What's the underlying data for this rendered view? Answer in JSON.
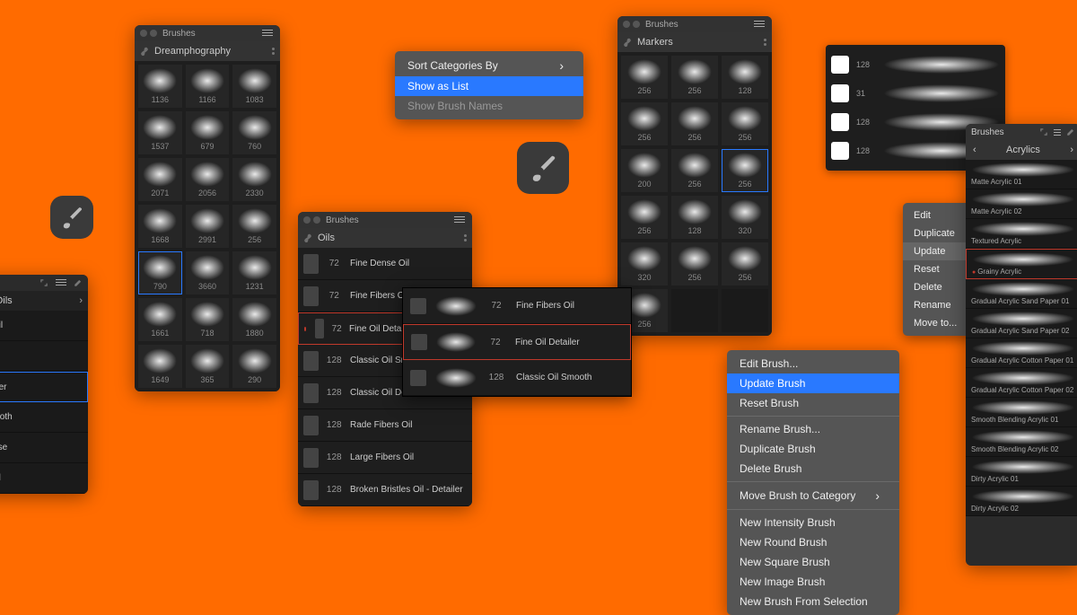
{
  "panel_grid": {
    "title": "Brushes",
    "category": "Dreamphography",
    "cells": [
      {
        "size": "1136"
      },
      {
        "size": "1166"
      },
      {
        "size": "1083"
      },
      {
        "size": "1537"
      },
      {
        "size": "679"
      },
      {
        "size": "760"
      },
      {
        "size": "2071"
      },
      {
        "size": "2056"
      },
      {
        "size": "2330"
      },
      {
        "size": "1668"
      },
      {
        "size": "2991"
      },
      {
        "size": "256"
      },
      {
        "size": "790",
        "selected": true
      },
      {
        "size": "3660"
      },
      {
        "size": "1231"
      },
      {
        "size": "1661"
      },
      {
        "size": "718"
      },
      {
        "size": "1880"
      },
      {
        "size": "1649"
      },
      {
        "size": "365"
      },
      {
        "size": "290"
      }
    ]
  },
  "panel_brushes2": {
    "title": "Brushes",
    "category": "Markers",
    "cells": [
      {
        "size": "256"
      },
      {
        "size": "256"
      },
      {
        "size": "128"
      },
      {
        "size": "256"
      },
      {
        "size": "256"
      },
      {
        "size": "256"
      },
      {
        "size": "200"
      },
      {
        "size": "256"
      },
      {
        "size": "256",
        "selected": true
      },
      {
        "size": "256"
      },
      {
        "size": "128"
      },
      {
        "size": "320"
      },
      {
        "size": "320"
      },
      {
        "size": "256"
      },
      {
        "size": "256"
      },
      {
        "size": "256"
      },
      {
        "size": ""
      },
      {
        "size": ""
      }
    ]
  },
  "panel_oils": {
    "title": "Brushes",
    "category": "Oils",
    "rows": [
      {
        "num": "72",
        "name": "Fine Dense Oil"
      },
      {
        "num": "72",
        "name": "Fine Fibers Oil"
      },
      {
        "num": "72",
        "name": "Fine Oil Detailer",
        "selected": true,
        "reddot": true
      },
      {
        "num": "128",
        "name": "Classic Oil Smooth"
      },
      {
        "num": "128",
        "name": "Classic Oil Dense"
      },
      {
        "num": "128",
        "name": "Rade Fibers Oil"
      },
      {
        "num": "128",
        "name": "Large Fibers Oil"
      },
      {
        "num": "128",
        "name": "Broken Bristles Oil - Detailer"
      }
    ]
  },
  "sublist": {
    "rows": [
      {
        "num": "72",
        "name": "Fine Fibers Oil"
      },
      {
        "num": "72",
        "name": "Fine Oil Detailer",
        "selected": true
      },
      {
        "num": "128",
        "name": "Classic Oil Smooth"
      }
    ]
  },
  "edge_panel": {
    "title_suffix": "es",
    "category": "Oils",
    "rows": [
      {
        "name": "nse Oil"
      },
      {
        "name": "rs Oil"
      },
      {
        "name": "Detailer",
        "selected": true
      },
      {
        "name": "il Smooth"
      },
      {
        "name": "il Dense"
      },
      {
        "name": "ers Oil"
      }
    ]
  },
  "sortmenu": {
    "items": [
      {
        "label": "Sort Categories By",
        "chev": true
      },
      {
        "label": "Show as List",
        "selected": true
      },
      {
        "label": "Show Brush Names",
        "dis": true
      }
    ]
  },
  "bigctx": {
    "items": [
      {
        "label": "Edit Brush..."
      },
      {
        "label": "Update Brush",
        "selected": true
      },
      {
        "label": "Reset Brush"
      },
      {
        "sep": true
      },
      {
        "label": "Rename Brush..."
      },
      {
        "label": "Duplicate Brush"
      },
      {
        "label": "Delete Brush"
      },
      {
        "sep": true
      },
      {
        "label": "Move Brush to Category",
        "chev": true
      },
      {
        "sep": true
      },
      {
        "label": "New Intensity Brush"
      },
      {
        "label": "New Round Brush"
      },
      {
        "label": "New Square Brush"
      },
      {
        "label": "New Image Brush"
      },
      {
        "label": "New Brush From Selection"
      }
    ]
  },
  "minimenu": {
    "items": [
      {
        "label": "Edit"
      },
      {
        "label": "Duplicate"
      },
      {
        "label": "Update",
        "selected": true
      },
      {
        "label": "Reset"
      },
      {
        "label": "Delete"
      },
      {
        "label": "Rename"
      },
      {
        "label": "Move to...",
        "chev": true
      }
    ]
  },
  "strip": {
    "rows": [
      {
        "num": "128"
      },
      {
        "num": "31"
      },
      {
        "num": "128"
      },
      {
        "num": "128"
      }
    ]
  },
  "rightlib": {
    "title": "Brushes",
    "category": "Acrylics",
    "rows": [
      {
        "name": "Matte Acrylic 01"
      },
      {
        "name": "Matte Acrylic 02"
      },
      {
        "name": "Textured Acrylic"
      },
      {
        "name": "Grainy Acrylic",
        "selected": true,
        "reddot": true
      },
      {
        "name": "Gradual Acrylic Sand Paper 01"
      },
      {
        "name": "Gradual Acrylic Sand Paper 02"
      },
      {
        "name": "Gradual Acrylic Cotton Paper 01"
      },
      {
        "name": "Gradual Acrylic Cotton Paper 02"
      },
      {
        "name": "Smooth Blending Acrylic 01"
      },
      {
        "name": "Smooth Blending Acrylic 02"
      },
      {
        "name": "Dirty Acrylic 01"
      },
      {
        "name": "Dirty Acrylic 02"
      }
    ]
  }
}
